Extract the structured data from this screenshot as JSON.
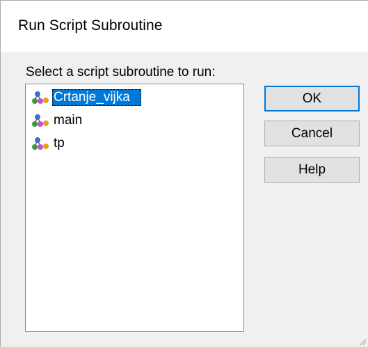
{
  "window": {
    "title": "Run Script Subroutine"
  },
  "prompt_label": "Select a script subroutine to run:",
  "subroutines": [
    {
      "label": "Crtanje_vijka",
      "selected": true,
      "icon": "subroutine-icon"
    },
    {
      "label": "main",
      "selected": false,
      "icon": "subroutine-icon"
    },
    {
      "label": "tp",
      "selected": false,
      "icon": "subroutine-icon"
    }
  ],
  "buttons": {
    "ok": "OK",
    "cancel": "Cancel",
    "help": "Help"
  },
  "colors": {
    "selection": "#0078d7",
    "dialog_bg": "#f0f0f0",
    "button_bg": "#e1e1e1"
  }
}
